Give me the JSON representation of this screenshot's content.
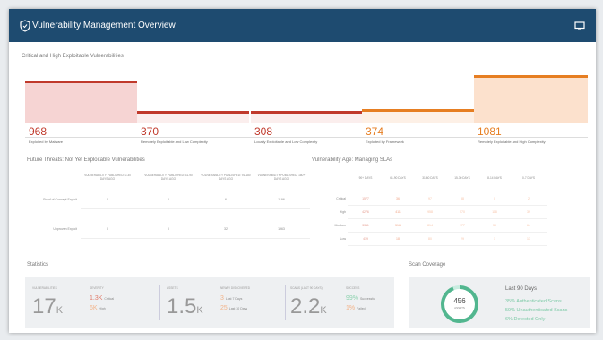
{
  "header": {
    "title": "Vulnerability Management Overview"
  },
  "critical": {
    "title": "Critical and High Exploitable Vulnerabilities",
    "items": [
      {
        "value": "968",
        "label": "Exploited by Malware",
        "color": "#c0392b",
        "fill": "#f6d4d3"
      },
      {
        "value": "370",
        "label": "Remotely Exploitable and Low Complexity",
        "color": "#c0392b",
        "fill": "#fbeeed"
      },
      {
        "value": "308",
        "label": "Locally Exploitable and Low Complexity",
        "color": "#c0392b",
        "fill": "#fbeeed"
      },
      {
        "value": "374",
        "label": "Exploited by Framework",
        "color": "#e67e22",
        "fill": "#fdf0e6"
      },
      {
        "value": "1081",
        "label": "Remotely Exploitable and High Complexity",
        "color": "#e67e22",
        "fill": "#fce1cd"
      }
    ]
  },
  "future": {
    "title": "Future Threats: Not Yet Exploitable Vulnerabilities",
    "cols": [
      "VULNERABILITY PUBLISHED: 0-30 DAYS AGO",
      "VULNERABILITY PUBLISHED: 31-90 DAYS AGO",
      "VULNERABILITY PUBLISHED: 91-180 DAYS AGO",
      "VULNERABILITY PUBLISHED: 180+ DAYS AGO"
    ],
    "rows": [
      {
        "label": "Proof of Concept Exploit",
        "values": [
          "0",
          "0",
          "6",
          "1196"
        ]
      },
      {
        "label": "Unproven Exploit",
        "values": [
          "0",
          "0",
          "32",
          "1963"
        ]
      }
    ]
  },
  "sla": {
    "title": "Vulnerability Age: Managing SLAs",
    "cols": [
      "90+ DAYS",
      "61-90 DAYS",
      "31-60 DAYS",
      "15-30 DAYS",
      "8-14 DAYS",
      "0-7 DAYS"
    ],
    "rows": [
      {
        "label": "Critical",
        "values": [
          "1577",
          "36",
          "97",
          "38",
          "0",
          "2"
        ]
      },
      {
        "label": "High",
        "values": [
          "4276",
          "411",
          "958",
          "570",
          "118",
          "39"
        ]
      },
      {
        "label": "Medium",
        "values": [
          "3311",
          "516",
          "814",
          "177",
          "39",
          "64"
        ]
      },
      {
        "label": "Low",
        "values": [
          "419",
          "18",
          "80",
          "29",
          "1",
          "13"
        ]
      }
    ]
  },
  "stats": {
    "title": "Statistics",
    "vulnerabilities": {
      "label": "VULNERABILITIES",
      "value": "17",
      "suffix": "K"
    },
    "severity": {
      "label": "SEVERITY",
      "critical_val": "1.3K",
      "critical_lbl": "Critical",
      "high_val": "6K",
      "high_lbl": "High"
    },
    "assets": {
      "label": "ASSETS",
      "value": "1.5",
      "suffix": "K"
    },
    "newly": {
      "label": "NEWLY DISCOVERED",
      "a_val": "3",
      "a_lbl": "Last 7 Days",
      "b_val": "25",
      "b_lbl": "Last 30 Days"
    },
    "scans": {
      "label": "SCANS (LAST 90 DAYS)",
      "value": "2.2",
      "suffix": "K"
    },
    "success": {
      "label": "SUCCESS",
      "a_val": "99%",
      "a_lbl": "Successful",
      "b_val": "1%",
      "b_lbl": "Failed"
    }
  },
  "coverage": {
    "title": "Scan Coverage",
    "total": "456",
    "total_lbl": "ASSETS",
    "period": "Last 90 Days",
    "lines": [
      {
        "pct": "35%",
        "text": "Authenticated Scans"
      },
      {
        "pct": "59%",
        "text": "Unauthenticated Scans"
      },
      {
        "pct": "6%",
        "text": "Detected Only"
      }
    ]
  }
}
